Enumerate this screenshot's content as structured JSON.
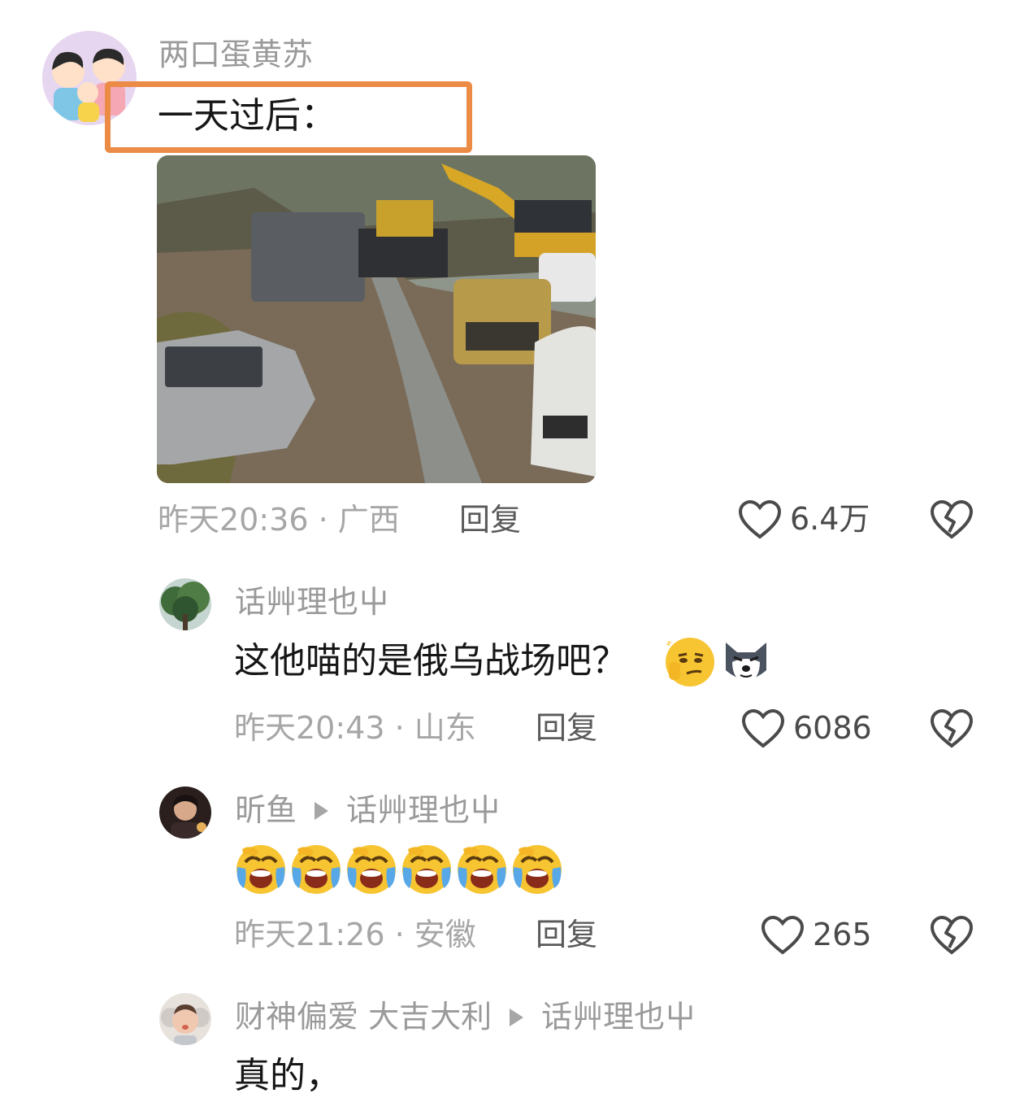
{
  "colors": {
    "highlight": "#ec8b46",
    "name": "#9a9a9a",
    "meta": "#a6a6a6",
    "text": "#161616"
  },
  "comments": [
    {
      "author": "两口蛋黄苏",
      "text": "一天过后：",
      "avatar_icon": "family-cartoon-avatar",
      "image_icon": "muddy-road-vehicles-photo",
      "time": "昨天20:36",
      "location": "广西",
      "reply": "回复",
      "likes": "6.4万"
    },
    {
      "author": "话艸理也屮",
      "text": "这他喵的是俄乌战场吧？",
      "emojis": [
        "thinking-smirk-emoji",
        "husky-dog-emoji"
      ],
      "avatar_icon": "tree-photo-avatar",
      "time": "昨天20:43",
      "location": "山东",
      "reply": "回复",
      "likes": "6086"
    },
    {
      "author": "昕鱼",
      "reply_to": "话艸理也屮",
      "text": "",
      "emojis": [
        "laugh-cry-emoji",
        "laugh-cry-emoji",
        "laugh-cry-emoji",
        "laugh-cry-emoji",
        "laugh-cry-emoji",
        "laugh-cry-emoji"
      ],
      "avatar_icon": "person-photo-avatar",
      "time": "昨天21:26",
      "location": "安徽",
      "reply": "回复",
      "likes": "265"
    },
    {
      "author": "财神偏爱 大吉大利",
      "reply_to": "话艸理也屮",
      "text": "真的，",
      "avatar_icon": "child-photo-avatar"
    }
  ]
}
